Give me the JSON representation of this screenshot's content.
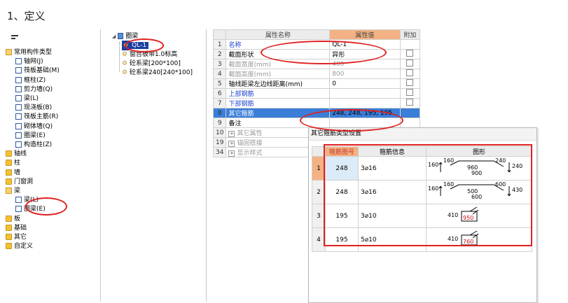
{
  "heading": "1、定义",
  "left_tree": {
    "items": [
      {
        "label": "常用构件类型",
        "icon": "folder-open-icon",
        "level": 0
      },
      {
        "label": "轴网(J)",
        "icon": "axis-grid-icon",
        "level": 1
      },
      {
        "label": "筏板基础(M)",
        "icon": "raft-foundation-icon",
        "level": 1
      },
      {
        "label": "框柱(Z)",
        "icon": "frame-column-icon",
        "level": 1
      },
      {
        "label": "剪力墙(Q)",
        "icon": "shear-wall-icon",
        "level": 1
      },
      {
        "label": "梁(L)",
        "icon": "beam-icon",
        "level": 1
      },
      {
        "label": "现浇板(B)",
        "icon": "cast-slab-icon",
        "level": 1
      },
      {
        "label": "筏板主筋(R)",
        "icon": "raft-rebar-icon",
        "level": 1
      },
      {
        "label": "砌体墙(Q)",
        "icon": "masonry-wall-icon",
        "level": 1
      },
      {
        "label": "圈梁(E)",
        "icon": "ring-beam-icon",
        "level": 1
      },
      {
        "label": "构造柱(Z)",
        "icon": "structural-column-icon",
        "level": 1
      },
      {
        "label": "轴线",
        "icon": "folder-icon",
        "level": 0
      },
      {
        "label": "柱",
        "icon": "folder-icon",
        "level": 0
      },
      {
        "label": "墙",
        "icon": "folder-icon",
        "level": 0
      },
      {
        "label": "门窗洞",
        "icon": "folder-icon",
        "level": 0
      },
      {
        "label": "梁",
        "icon": "folder-open-icon",
        "level": 0
      },
      {
        "label": "梁(L)",
        "icon": "beam-icon",
        "level": 1
      },
      {
        "label": "圈梁(E)",
        "icon": "ring-beam-icon",
        "level": 1
      },
      {
        "label": "板",
        "icon": "folder-icon",
        "level": 0
      },
      {
        "label": "基础",
        "icon": "folder-icon",
        "level": 0
      },
      {
        "label": "其它",
        "icon": "folder-icon",
        "level": 0
      },
      {
        "label": "自定义",
        "icon": "folder-icon",
        "level": 0
      }
    ]
  },
  "mid_tree": {
    "root": "圈梁",
    "items": [
      "QL-1",
      "窗台板带1.0标高",
      "砼系梁[200*100]",
      "砼系梁240[240*100]"
    ]
  },
  "props": {
    "headers": {
      "name": "属性名称",
      "value": "属性值",
      "extra": "附加"
    },
    "rows": [
      {
        "n": "1",
        "name": "名称",
        "value": "QL-1",
        "style": "blue",
        "chk": false
      },
      {
        "n": "2",
        "name": "截面形状",
        "value": "异形",
        "style": "normal",
        "chk": true
      },
      {
        "n": "3",
        "name": "截面宽度(mm)",
        "value": "400",
        "style": "grey",
        "chk": true
      },
      {
        "n": "4",
        "name": "截面高度(mm)",
        "value": "800",
        "style": "grey",
        "chk": true
      },
      {
        "n": "5",
        "name": "轴线距梁左边线距离(mm)",
        "value": "0",
        "style": "normal",
        "chk": true
      },
      {
        "n": "6",
        "name": "上部钢筋",
        "value": "",
        "style": "blue",
        "chk": true
      },
      {
        "n": "7",
        "name": "下部钢筋",
        "value": "",
        "style": "blue",
        "chk": true
      },
      {
        "n": "8",
        "name": "其它箍筋",
        "value": "248, 248, 195, 195",
        "style": "selected",
        "chk": false
      },
      {
        "n": "9",
        "name": "备注",
        "value": "",
        "style": "normal",
        "chk": false
      },
      {
        "n": "10",
        "name": "其它属性",
        "value": "",
        "style": "grey-expand",
        "chk": false
      },
      {
        "n": "19",
        "name": "锚固搭接",
        "value": "",
        "style": "grey-expand",
        "chk": false
      },
      {
        "n": "34",
        "name": "显示样式",
        "value": "",
        "style": "grey-expand",
        "chk": false
      }
    ]
  },
  "dialog": {
    "title": "其它箍筋类型设置",
    "headers": {
      "no": "箍筋图号",
      "info": "箍筋信息",
      "shape": "图形"
    },
    "rows": [
      {
        "n": "1",
        "no": "248",
        "info": "3⌀16",
        "dims": [
          "160",
          "160",
          "960",
          "900",
          "240",
          "240"
        ]
      },
      {
        "n": "2",
        "no": "248",
        "info": "3⌀16",
        "dims": [
          "160",
          "160",
          "500",
          "600",
          "600",
          "430"
        ]
      },
      {
        "n": "3",
        "no": "195",
        "info": "3⌀10",
        "dims": [
          "410",
          "950"
        ]
      },
      {
        "n": "4",
        "no": "195",
        "info": "5⌀10",
        "dims": [
          "410",
          "760"
        ]
      }
    ]
  },
  "colors": {
    "highlight": "#e02020",
    "selected_row": "#3a7ed8",
    "header_accent": "#f4b183"
  }
}
